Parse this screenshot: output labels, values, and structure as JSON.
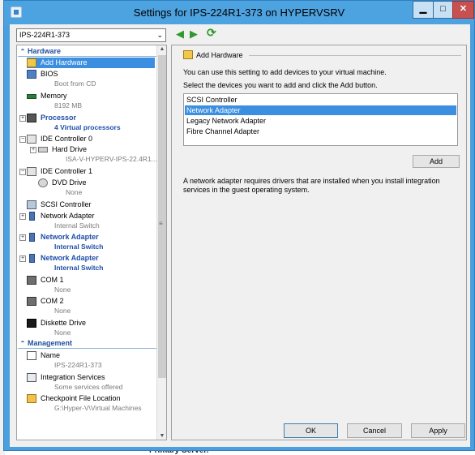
{
  "window": {
    "title": "Settings for IPS-224R1-373 on HYPERVSRV",
    "min_glyph": "▁",
    "max_glyph": "□",
    "close_glyph": "✕"
  },
  "toolbar": {
    "vm_selected": "IPS-224R1-373",
    "back_glyph": "◀",
    "forward_glyph": "▶",
    "refresh_glyph": "⟳"
  },
  "tree": {
    "hardware_header": "Hardware",
    "management_header": "Management",
    "items": {
      "add_hardware": "Add Hardware",
      "bios": "BIOS",
      "bios_sub": "Boot from CD",
      "memory": "Memory",
      "memory_sub": "8192 MB",
      "processor": "Processor",
      "processor_sub": "4 Virtual processors",
      "ide0": "IDE Controller 0",
      "hard_drive": "Hard Drive",
      "hard_drive_sub": "ISA-V-HYPERV-IPS-22.4R1...",
      "ide1": "IDE Controller 1",
      "dvd": "DVD Drive",
      "dvd_sub": "None",
      "scsi": "SCSI Controller",
      "nic1": "Network Adapter",
      "nic1_sub": "Internal Switch",
      "nic2": "Network Adapter",
      "nic2_sub": "Internal Switch",
      "nic3": "Network Adapter",
      "nic3_sub": "Internal Switch",
      "com1": "COM 1",
      "com1_sub": "None",
      "com2": "COM 2",
      "com2_sub": "None",
      "diskette": "Diskette Drive",
      "diskette_sub": "None",
      "name": "Name",
      "name_sub": "IPS-224R1-373",
      "integration": "Integration Services",
      "integration_sub": "Some services offered",
      "checkpoint": "Checkpoint File Location",
      "checkpoint_sub": "G:\\Hyper-V\\Virtual Machines"
    }
  },
  "panel": {
    "heading": "Add Hardware",
    "intro": "You can use this setting to add devices to your virtual machine.",
    "instruction": "Select the devices you want to add and click the Add button.",
    "devices": [
      "SCSI Controller",
      "Network Adapter",
      "Legacy Network Adapter",
      "Fibre Channel Adapter"
    ],
    "selected_device": "Network Adapter",
    "add_label": "Add",
    "note": "A network adapter requires drivers that are installed when you install integration services in the guest operating system."
  },
  "buttons": {
    "ok": "OK",
    "cancel": "Cancel",
    "apply": "Apply"
  },
  "background": {
    "text": "Primary Server."
  }
}
